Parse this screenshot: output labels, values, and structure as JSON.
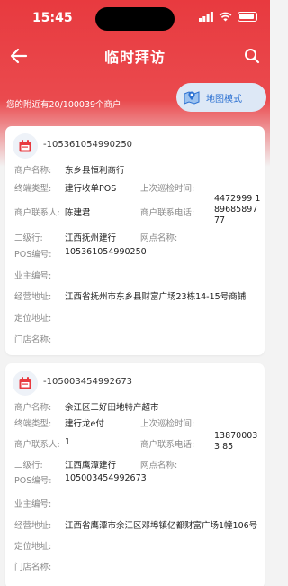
{
  "status": {
    "time": "15:45"
  },
  "header": {
    "title": "临时拜访"
  },
  "nearby_text": "您的附近有20/100039个商户",
  "map_mode": {
    "label": "地图模式"
  },
  "colors": {
    "brand_red": "#e83a3f",
    "map_blue": "#2d72d2"
  },
  "labels": {
    "merchant_name": "商户名称:",
    "terminal_type": "终端类型:",
    "last_inspection": "上次巡检时间:",
    "merchant_contact": "商户联系人:",
    "merchant_phone": "商户联系电话:",
    "secondary_branch": "二级行:",
    "outlet_name": "网点名称:",
    "pos_no": "POS编号:",
    "owner_no": "业主编号:",
    "business_address": "经营地址:",
    "location_address": "定位地址:",
    "store_name": "门店名称:"
  },
  "merchants": [
    {
      "id": "-105361054990250",
      "name": "东乡县恒利商行",
      "terminal_type": "建行收单POS",
      "last_inspection": "",
      "contact": "陈建君",
      "phone": "4472999 189685897 77",
      "secondary_branch": "江西抚州建行",
      "outlet_name": "",
      "pos_no": "105361054990250",
      "owner_no": "",
      "business_address": "江西省抚州市东乡县财富广场23栋14-15号商铺",
      "location_address": "",
      "store_name": ""
    },
    {
      "id": "-105003454992673",
      "name": "余江区三好田地特产超市",
      "terminal_type": "建行龙e付",
      "last_inspection": "",
      "contact": "1",
      "phone": "138700033 85",
      "secondary_branch": "江西鹰潭建行",
      "outlet_name": "",
      "pos_no": "105003454992673",
      "owner_no": "",
      "business_address": "江西省鹰潭市余江区邓埠镇亿都财富广场1幢106号",
      "location_address": "",
      "store_name": ""
    }
  ]
}
